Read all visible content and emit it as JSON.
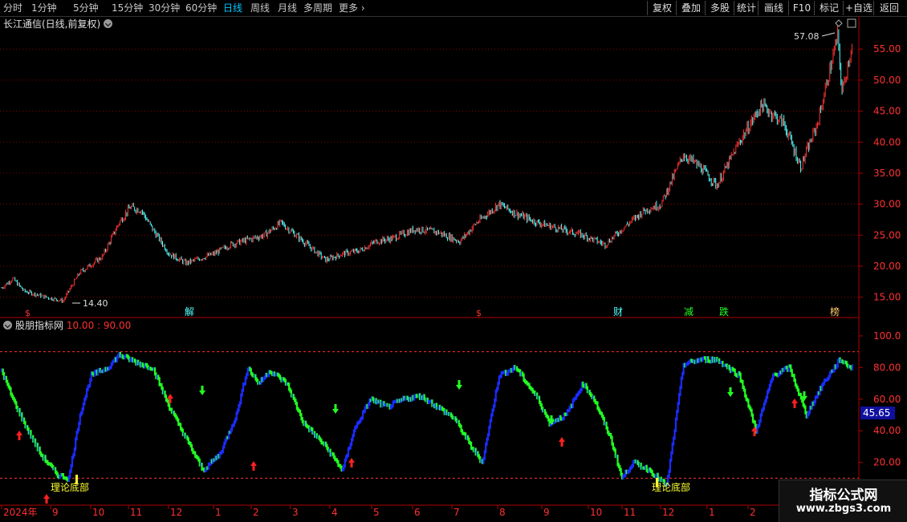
{
  "toolbar": {
    "periods": [
      "分时",
      "1分钟",
      "5分钟",
      "15分钟",
      "30分钟",
      "60分钟",
      "日线",
      "周线",
      "月线",
      "多周期",
      "更多"
    ],
    "active_period": "日线",
    "right_buttons": [
      "复权",
      "叠加",
      "多股",
      "统计",
      "画线",
      "F10",
      "标记",
      "+自选",
      "返回"
    ]
  },
  "header": {
    "title": "长江通信(日线,前复权)"
  },
  "indicator": {
    "name": "股朋指标网",
    "params": "10.00 : 90.00",
    "current_value": "45.65",
    "bottom_labels": [
      "理论底部",
      "理论底部"
    ]
  },
  "price_chart": {
    "y_ticks": [
      "55.00",
      "50.00",
      "45.00",
      "40.00",
      "35.00",
      "30.00",
      "25.00",
      "20.00",
      "15.00"
    ],
    "max_label": "57.08",
    "min_label": "14.40",
    "event_markers": [
      "$",
      "解",
      "$",
      "财",
      "减",
      "跌",
      "榜"
    ]
  },
  "indicator_axis": {
    "y_ticks": [
      "100.0",
      "80.00",
      "60.00",
      "40.00",
      "20.00"
    ]
  },
  "x_axis": {
    "labels": [
      "2024年",
      "9",
      "10",
      "11",
      "12",
      "1",
      "2",
      "3",
      "4",
      "5",
      "6",
      "7",
      "8",
      "9",
      "10",
      "11",
      "12",
      "1",
      "2"
    ]
  },
  "watermark": {
    "line1": "指标公式网",
    "line2": "www.zbgs3.com"
  },
  "colors": {
    "up": "#ff3232",
    "down": "#54ffff",
    "ind_blue": "#1a2cff",
    "ind_green": "#22ff22",
    "grid": "#8b0000",
    "axis": "#b00000"
  },
  "chart_data": {
    "type": "candlestick",
    "price_anchors": [
      [
        0,
        16.5
      ],
      [
        10,
        18
      ],
      [
        20,
        16
      ],
      [
        40,
        15
      ],
      [
        55,
        14.4
      ],
      [
        60,
        16
      ],
      [
        70,
        19
      ],
      [
        90,
        21.5
      ],
      [
        105,
        27
      ],
      [
        115,
        29.5
      ],
      [
        125,
        29
      ],
      [
        135,
        26
      ],
      [
        150,
        22
      ],
      [
        165,
        20.5
      ],
      [
        190,
        22
      ],
      [
        205,
        23.5
      ],
      [
        215,
        24
      ],
      [
        235,
        25
      ],
      [
        250,
        27
      ],
      [
        270,
        24
      ],
      [
        290,
        21
      ],
      [
        305,
        22
      ],
      [
        320,
        22.5
      ],
      [
        335,
        24
      ],
      [
        350,
        24.5
      ],
      [
        370,
        26
      ],
      [
        390,
        25.5
      ],
      [
        410,
        24
      ],
      [
        425,
        27
      ],
      [
        445,
        30
      ],
      [
        460,
        28.5
      ],
      [
        480,
        27
      ],
      [
        500,
        26
      ],
      [
        520,
        25
      ],
      [
        540,
        23.5
      ],
      [
        555,
        26
      ],
      [
        575,
        29
      ],
      [
        590,
        30
      ],
      [
        610,
        38
      ],
      [
        625,
        36
      ],
      [
        640,
        33
      ],
      [
        660,
        40
      ],
      [
        680,
        46
      ],
      [
        700,
        43
      ],
      [
        715,
        36
      ],
      [
        730,
        43
      ],
      [
        748,
        57.08
      ],
      [
        752,
        48
      ],
      [
        760,
        55
      ]
    ],
    "indicator_anchors": [
      [
        0,
        78
      ],
      [
        10,
        60
      ],
      [
        20,
        45
      ],
      [
        35,
        25
      ],
      [
        50,
        12
      ],
      [
        60,
        10
      ],
      [
        70,
        50
      ],
      [
        80,
        75
      ],
      [
        95,
        80
      ],
      [
        105,
        88
      ],
      [
        115,
        85
      ],
      [
        125,
        82
      ],
      [
        135,
        80
      ],
      [
        150,
        55
      ],
      [
        165,
        35
      ],
      [
        180,
        15
      ],
      [
        195,
        25
      ],
      [
        210,
        50
      ],
      [
        220,
        80
      ],
      [
        230,
        70
      ],
      [
        240,
        78
      ],
      [
        255,
        70
      ],
      [
        270,
        45
      ],
      [
        290,
        30
      ],
      [
        305,
        15
      ],
      [
        315,
        40
      ],
      [
        330,
        60
      ],
      [
        345,
        55
      ],
      [
        360,
        60
      ],
      [
        375,
        62
      ],
      [
        390,
        55
      ],
      [
        405,
        48
      ],
      [
        420,
        30
      ],
      [
        430,
        20
      ],
      [
        445,
        75
      ],
      [
        460,
        80
      ],
      [
        480,
        60
      ],
      [
        490,
        45
      ],
      [
        505,
        50
      ],
      [
        520,
        70
      ],
      [
        530,
        60
      ],
      [
        545,
        35
      ],
      [
        555,
        10
      ],
      [
        565,
        20
      ],
      [
        580,
        15
      ],
      [
        595,
        5
      ],
      [
        610,
        82
      ],
      [
        625,
        85
      ],
      [
        640,
        85
      ],
      [
        660,
        75
      ],
      [
        675,
        40
      ],
      [
        690,
        75
      ],
      [
        705,
        80
      ],
      [
        720,
        50
      ],
      [
        735,
        70
      ],
      [
        750,
        85
      ],
      [
        760,
        80
      ]
    ]
  }
}
